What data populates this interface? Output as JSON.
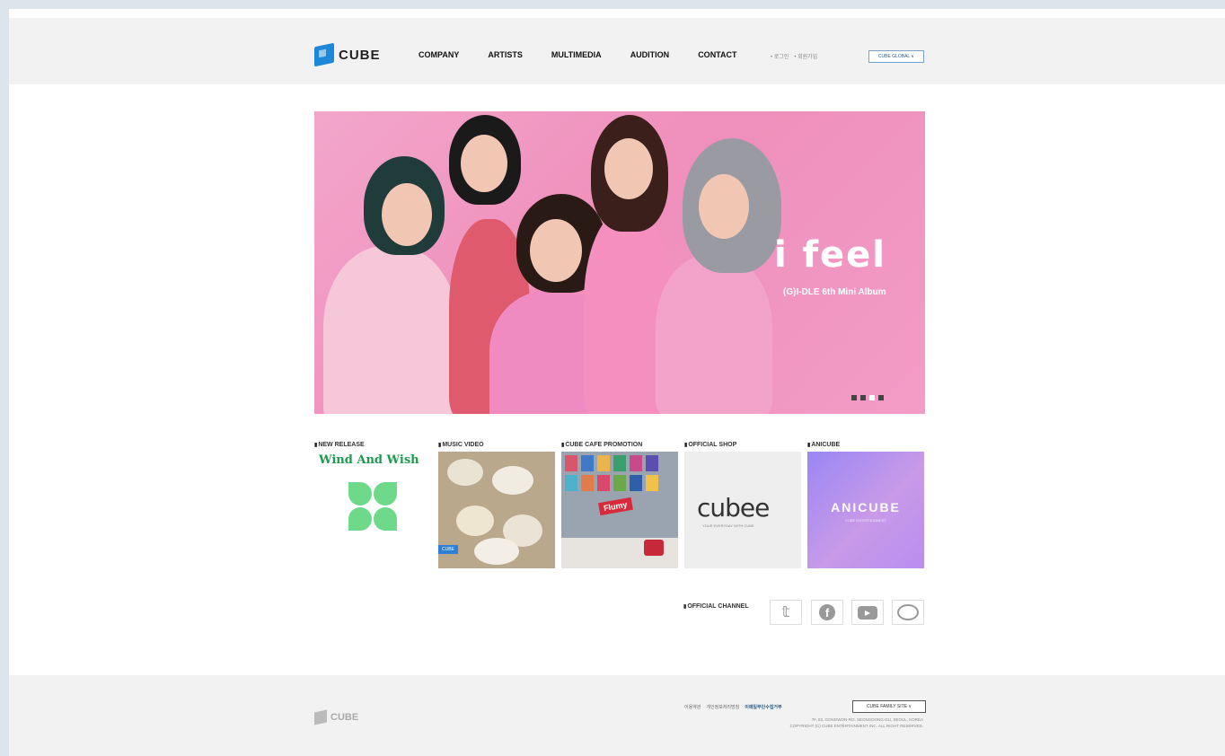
{
  "header": {
    "logo_text": "CUBE",
    "nav": [
      "COMPANY",
      "ARTISTS",
      "MULTIMEDIA",
      "AUDITION",
      "CONTACT"
    ],
    "util_links": [
      "• 로그인",
      "• 회원가입"
    ],
    "global_select": "CUBE GLOBAL ∨"
  },
  "banner": {
    "title_line1": "i feel",
    "subtitle": "(G)I-DLE 6th Mini Album",
    "slide_count": 4,
    "active_slide": 3
  },
  "tiles": [
    {
      "label": "NEW RELEASE",
      "content": "Wind And Wish"
    },
    {
      "label": "MUSIC VIDEO",
      "content": "CUBE"
    },
    {
      "label": "CUBE CAFE PROMOTION",
      "content": "Flumy"
    },
    {
      "label": "OFFICIAL SHOP",
      "content": "cubee",
      "content_sub": "YOUR EVERYDAY WITH CUBE"
    },
    {
      "label": "ANICUBE",
      "content": "ANICUBE",
      "content_sub": "CUBE ENTERTAINMENT"
    }
  ],
  "channel": {
    "label": "OFFICIAL CHANNEL",
    "icons": [
      "twitter-icon",
      "facebook-icon",
      "youtube-icon",
      "weibo-icon"
    ]
  },
  "footer": {
    "logo_text": "CUBE",
    "links": [
      "이용약관",
      "개인정보처리방침",
      "이메일무단수집거부"
    ],
    "family_select": "CUBE FAMILY SITE ∨",
    "copy_line1": "7F, 83, GONGWON-RO, SEONGDONG-GU, SEOUL, KOREA",
    "copy_line2": "COPYRIGHT (C) CUBE ENTERTAINMENT INC. ALL RIGHT RESERVED."
  },
  "colors": {
    "brand_blue": "#1d87d8",
    "banner_pink": "#ef8fbb",
    "anicube_purple": "#9a86f4",
    "release_green": "#1e9a4f"
  }
}
